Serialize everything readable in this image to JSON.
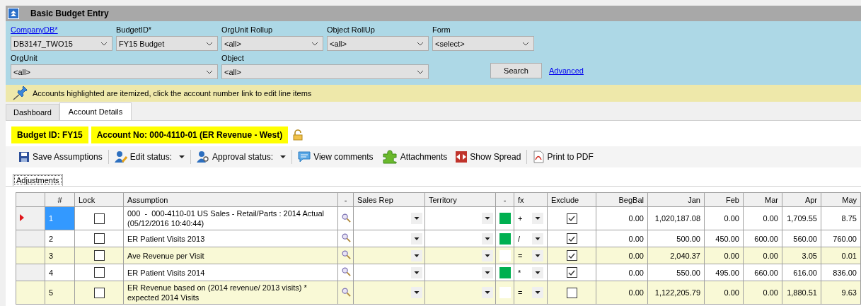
{
  "window": {
    "title": "Basic Budget Entry"
  },
  "filters": [
    [
      {
        "label": "CompanyDB*",
        "link": true,
        "value": "DB3147_TWO15"
      },
      {
        "label": "BudgetID*",
        "link": false,
        "value": "FY15 Budget"
      },
      {
        "label": "OrgUnit Rollup",
        "link": false,
        "value": "<all>"
      },
      {
        "label": "Object RollUp",
        "link": false,
        "value": "<all>"
      },
      {
        "label": "Form",
        "link": false,
        "value": "<select>"
      }
    ],
    [
      {
        "label": "OrgUnit",
        "link": false,
        "value": "<all>"
      },
      {
        "label": "Object",
        "link": false,
        "value": "<all>"
      }
    ]
  ],
  "search_button": "Search",
  "advanced_link": "Advanced",
  "note": "Accounts highlighted are itemized, click the account number link to edit line items",
  "tabs": [
    {
      "label": "Dashboard",
      "selected": false
    },
    {
      "label": "Account Details",
      "selected": true
    }
  ],
  "badges": [
    "Budget ID: FY15",
    "Account No: 000-4110-01 (ER Revenue - West)"
  ],
  "toolbar": [
    {
      "label": "Save Assumptions",
      "kind": "button"
    },
    {
      "label": "Edit status:",
      "kind": "dropdown"
    },
    {
      "label": "Approval status:",
      "kind": "dropdown"
    },
    {
      "label": "View comments",
      "kind": "button"
    },
    {
      "label": "Attachments",
      "kind": "button"
    },
    {
      "label": "Show Spread",
      "kind": "button"
    },
    {
      "label": "Print to PDF",
      "kind": "button"
    }
  ],
  "subtabs": [
    {
      "label": "Adjustments",
      "selected": true
    }
  ],
  "table": {
    "columns": [
      "#",
      "Lock",
      "Assumption",
      "-",
      "Sales Rep",
      "Territory",
      "-",
      "fx",
      "Exclude",
      "BegBal",
      "Jan",
      "Feb",
      "Mar",
      "Apr",
      "May"
    ],
    "rows": [
      {
        "number": "1",
        "selected": true,
        "itemized": false,
        "locked": false,
        "assumption": "000  -  000-4110-01 US Sales - Retail/Parts : 2014 Actual (05/12/2016 10:40:44)",
        "color": "#00b050",
        "op": "+",
        "exclude": true,
        "values": [
          "0.00",
          "1,020,187.08",
          "0.00",
          "0.00",
          "1,709.55",
          "8.75"
        ]
      },
      {
        "number": "2",
        "selected": false,
        "itemized": false,
        "locked": false,
        "assumption": "ER Patient Visits 2013",
        "color": "#00b050",
        "op": "/",
        "exclude": true,
        "values": [
          "0.00",
          "500.00",
          "450.00",
          "600.00",
          "560.00",
          "760.00"
        ]
      },
      {
        "number": "3",
        "selected": false,
        "itemized": true,
        "locked": false,
        "assumption": "Ave Revenue per Visit",
        "color": "#ffffff",
        "op": "=",
        "exclude": true,
        "values": [
          "0.00",
          "2,040.37",
          "0.00",
          "0.00",
          "3.05",
          "0.01"
        ]
      },
      {
        "number": "4",
        "selected": false,
        "itemized": false,
        "locked": false,
        "assumption": "ER Patient Visits 2014",
        "color": "#00b050",
        "op": "*",
        "exclude": true,
        "values": [
          "0.00",
          "550.00",
          "495.00",
          "660.00",
          "616.00",
          "836.00"
        ]
      },
      {
        "number": "5",
        "selected": false,
        "itemized": true,
        "locked": false,
        "assumption": "ER Revenue based on (2014 revenue/ 2013 visits) * expected 2014 Visits",
        "color": "#ffffff",
        "op": "=",
        "exclude": false,
        "values": [
          "0.00",
          "1,122,205.79",
          "0.00",
          "0.00",
          "1,880.51",
          "9.63"
        ]
      }
    ]
  }
}
